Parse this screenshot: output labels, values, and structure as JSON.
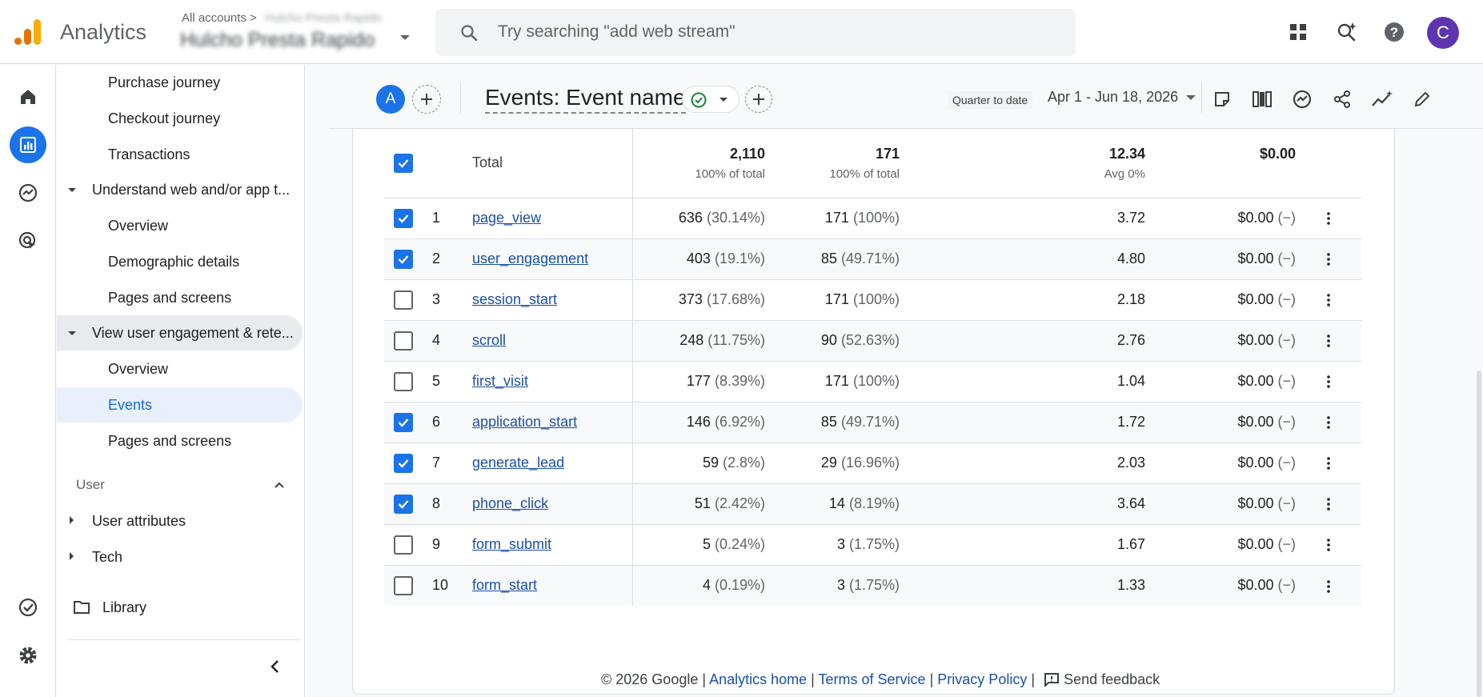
{
  "app": {
    "title": "Analytics",
    "breadcrumb": "All accounts",
    "breadcrumb_sep": ">",
    "breadcrumb_blurred": "Hulcho Presta Rapido",
    "account_name": "Hulcho Presta Rapido",
    "avatar_letter": "C",
    "accent_color": "#1a73e8"
  },
  "search": {
    "placeholder": "Try searching \"add web stream\""
  },
  "sidebar": {
    "items": {
      "purchase_journey": "Purchase journey",
      "checkout_journey": "Checkout journey",
      "transactions": "Transactions",
      "understand_group": "Understand web and/or app t...",
      "overview1": "Overview",
      "demographic": "Demographic details",
      "pages1": "Pages and screens",
      "engagement_group": "View user engagement & rete...",
      "overview2": "Overview",
      "events": "Events",
      "pages2": "Pages and screens"
    },
    "user_section": "User",
    "user_attributes": "User attributes",
    "tech": "Tech",
    "library": "Library"
  },
  "report": {
    "comparison_letter": "A",
    "title": "Events: Event name",
    "date_chip": "Quarter to date",
    "date_range": "Apr 1 - Jun 18, 2026"
  },
  "table": {
    "total_label": "Total",
    "totals": {
      "m1": "2,110",
      "m1_sub": "100% of total",
      "m2": "171",
      "m2_sub": "100% of total",
      "m3": "12.34",
      "m3_sub": "Avg 0%",
      "m4": "$0.00"
    },
    "rows": [
      {
        "idx": "1",
        "name": "page_view",
        "m1": "636",
        "m1p": "(30.14%)",
        "m2": "171",
        "m2p": "(100%)",
        "m3": "3.72",
        "m4": "$0.00",
        "m4p": "(−)",
        "checked": true
      },
      {
        "idx": "2",
        "name": "user_engagement",
        "m1": "403",
        "m1p": "(19.1%)",
        "m2": "85",
        "m2p": "(49.71%)",
        "m3": "4.80",
        "m4": "$0.00",
        "m4p": "(−)",
        "checked": true
      },
      {
        "idx": "3",
        "name": "session_start",
        "m1": "373",
        "m1p": "(17.68%)",
        "m2": "171",
        "m2p": "(100%)",
        "m3": "2.18",
        "m4": "$0.00",
        "m4p": "(−)",
        "checked": false
      },
      {
        "idx": "4",
        "name": "scroll",
        "m1": "248",
        "m1p": "(11.75%)",
        "m2": "90",
        "m2p": "(52.63%)",
        "m3": "2.76",
        "m4": "$0.00",
        "m4p": "(−)",
        "checked": false
      },
      {
        "idx": "5",
        "name": "first_visit",
        "m1": "177",
        "m1p": "(8.39%)",
        "m2": "171",
        "m2p": "(100%)",
        "m3": "1.04",
        "m4": "$0.00",
        "m4p": "(−)",
        "checked": false
      },
      {
        "idx": "6",
        "name": "application_start",
        "m1": "146",
        "m1p": "(6.92%)",
        "m2": "85",
        "m2p": "(49.71%)",
        "m3": "1.72",
        "m4": "$0.00",
        "m4p": "(−)",
        "checked": true
      },
      {
        "idx": "7",
        "name": "generate_lead",
        "m1": "59",
        "m1p": "(2.8%)",
        "m2": "29",
        "m2p": "(16.96%)",
        "m3": "2.03",
        "m4": "$0.00",
        "m4p": "(−)",
        "checked": true
      },
      {
        "idx": "8",
        "name": "phone_click",
        "m1": "51",
        "m1p": "(2.42%)",
        "m2": "14",
        "m2p": "(8.19%)",
        "m3": "3.64",
        "m4": "$0.00",
        "m4p": "(−)",
        "checked": true
      },
      {
        "idx": "9",
        "name": "form_submit",
        "m1": "5",
        "m1p": "(0.24%)",
        "m2": "3",
        "m2p": "(1.75%)",
        "m3": "1.67",
        "m4": "$0.00",
        "m4p": "(−)",
        "checked": false
      },
      {
        "idx": "10",
        "name": "form_start",
        "m1": "4",
        "m1p": "(0.19%)",
        "m2": "3",
        "m2p": "(1.75%)",
        "m3": "1.33",
        "m4": "$0.00",
        "m4p": "(−)",
        "checked": false
      }
    ]
  },
  "footer": {
    "copyright": "© 2026 Google",
    "sep": "|",
    "analytics_home": "Analytics home",
    "terms": "Terms of Service",
    "privacy": "Privacy Policy",
    "feedback": "Send feedback"
  }
}
